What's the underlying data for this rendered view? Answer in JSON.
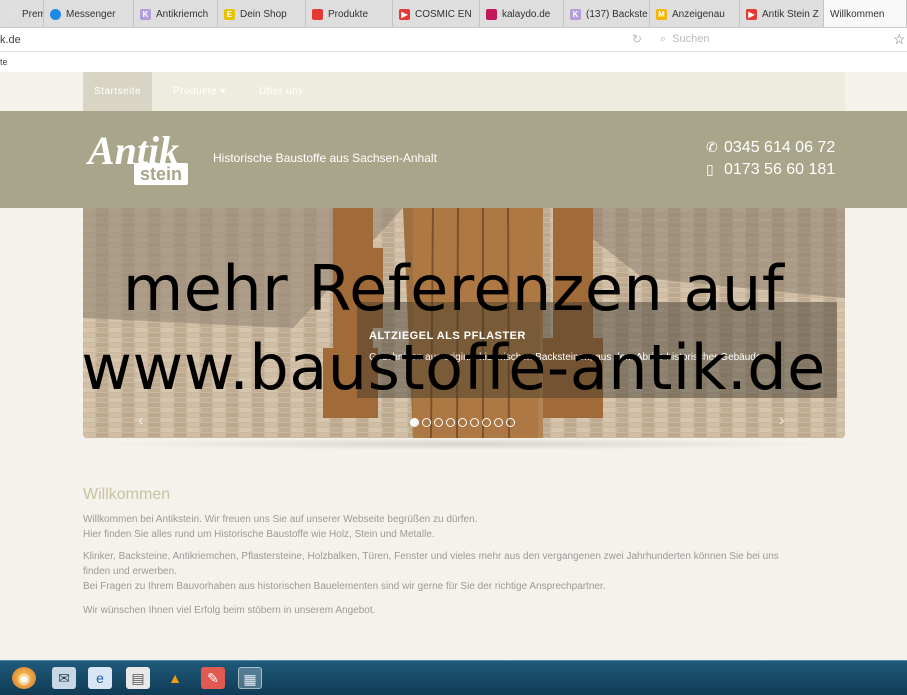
{
  "browser": {
    "tabs": [
      {
        "label": "Premi",
        "favicon_color": "#e0e0e0"
      },
      {
        "label": "Messenger",
        "favicon_color": "#1e88e5"
      },
      {
        "label": "Antikriemch",
        "favicon_color": "#b39ddb"
      },
      {
        "label": "Dein Shop",
        "favicon_color": "#e6c200"
      },
      {
        "label": "Produkte",
        "favicon_color": "#e53935"
      },
      {
        "label": "COSMIC EN",
        "favicon_color": "#e53935"
      },
      {
        "label": "kalaydo.de",
        "favicon_color": "#c2185b"
      },
      {
        "label": "(137) Backste",
        "favicon_color": "#b39ddb"
      },
      {
        "label": "Anzeigenau",
        "favicon_color": "#f5b400"
      },
      {
        "label": "Antik Stein Z",
        "favicon_color": "#e53935"
      },
      {
        "label": "Willkommen",
        "favicon_color": "#ffffff"
      }
    ],
    "url": "k.de",
    "search_placeholder": "Suchen",
    "bookmark_text": "te"
  },
  "site": {
    "nav": {
      "items": [
        {
          "label": "Startseite"
        },
        {
          "label": "Produkte ▾"
        },
        {
          "label": "Über uns"
        }
      ]
    },
    "header": {
      "logo_antik": "Antik",
      "logo_stein": "stein",
      "tagline": "Historische Baustoffe aus Sachsen-Anhalt",
      "phone": "0345 614 06 72",
      "mobile": "0173 56 60 181"
    },
    "slider": {
      "caption_title": "ALTZIEGEL ALS PFLASTER",
      "caption_text": "Geschnitten aus original historischen Backsteinen, aus dem Abriss historischer Gebäude",
      "total_slides": 9,
      "active_slide": 1
    },
    "content": {
      "title": "Willkommen",
      "p1_line1": "Willkommen bei Antikstein. Wir freuen uns Sie auf unserer Webseite begrüßen zu dürfen.",
      "p1_line2": "Hier finden Sie alles rund um Historische Baustoffe wie Holz, Stein und Metalle.",
      "p2_line1": "Klinker, Backsteine, Antikriemchen, Pflastersteine, Holzbalken, Türen, Fenster und vieles mehr aus den vergangenen zwei Jahrhunderten können Sie bei uns",
      "p2_line2": "finden und erwerben.",
      "p2_line3": "Bei Fragen zu Ihrem Bauvorhaben aus historischen Bauelementen sind wir gerne für Sie der richtige Ansprechpartner.",
      "p3": "Wir wünschen Ihnen viel Erfolg beim stöbern in unserem Angebot."
    }
  },
  "overlay": {
    "line1": "mehr Referenzen auf",
    "line2": "www.baustoffe-antik.de"
  },
  "taskbar": {
    "icons": [
      "start-orb-icon",
      "mail-icon",
      "ie-browser-icon",
      "explorer-icon",
      "vlc-icon",
      "pdf-reader-icon",
      "notepad-icon"
    ]
  }
}
